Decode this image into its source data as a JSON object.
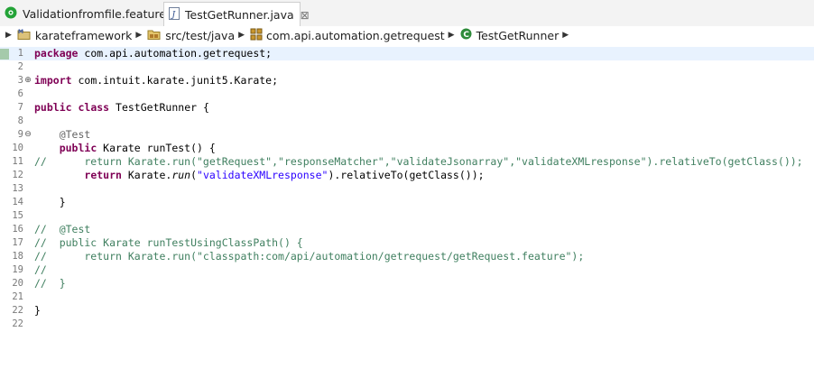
{
  "tabs": [
    {
      "label": "Validationfromfile.feature",
      "icon": "cucumber-icon",
      "active": false
    },
    {
      "label": "TestGetRunner.java",
      "icon": "java-file-icon",
      "active": true,
      "close_glyph": "⊠"
    }
  ],
  "breadcrumb": [
    "karateframework",
    "src/test/java",
    "com.api.automation.getrequest",
    "TestGetRunner"
  ],
  "editor": {
    "line_numbers": [
      "1",
      "2",
      "3",
      "6",
      "7",
      "8",
      "9",
      "10",
      "11",
      "12",
      "13",
      "14",
      "15",
      "16",
      "17",
      "18",
      "19",
      "20",
      "21",
      "22"
    ],
    "code": {
      "l1_kw": "package",
      "l1_rest": " com.api.automation.getrequest;",
      "l3_kw": "import",
      "l3_rest": " com.intuit.karate.junit5.Karate;",
      "l6_kw1": "public",
      "l6_sp1": " ",
      "l6_kw2": "class",
      "l6_rest": " TestGetRunner {",
      "l8_indent": "    ",
      "l8_ann": "@Test",
      "l9_indent": "    ",
      "l9_kw": "public",
      "l9_rest": " Karate runTest() {",
      "l10_comment": "//      return Karate.run(\"getRequest\",\"responseMatcher\",\"validateJsonarray\",\"validateXMLresponse\").relativeTo(getClass());",
      "l11_indent": "        ",
      "l11_kw": "return",
      "l11_a": " Karate.",
      "l11_run": "run",
      "l11_b": "(",
      "l11_str": "\"validateXMLresponse\"",
      "l11_c": ").relativeTo(getClass());",
      "l13": "    }",
      "l15": "//  @Test",
      "l16": "//  public Karate runTestUsingClassPath() {",
      "l17": "//      return Karate.run(\"classpath:com/api/automation/getrequest/getRequest.feature\");",
      "l18": "//",
      "l19": "//  }",
      "l21": "}"
    }
  },
  "colors": {
    "keyword": "#7f0055",
    "string": "#2a00ff",
    "comment": "#3f7f5f",
    "annotation": "#646464"
  }
}
